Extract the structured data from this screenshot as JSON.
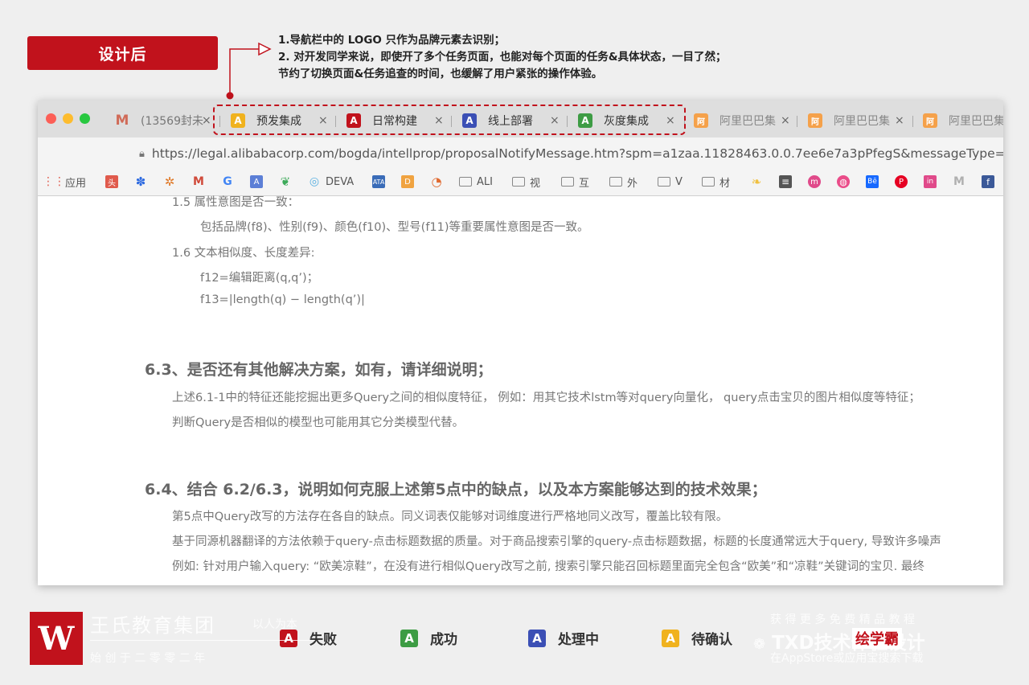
{
  "badge": "设计后",
  "notes": [
    "1.导航栏中的 LOGO 只作为品牌元素去识别；",
    "2. 对开发同学来说，即使开了多个任务页面，也能对每个页面的任务&具体状态，一目了然；",
    "节约了切换页面&任务追查的时间，也缓解了用户紧张的操作体验。"
  ],
  "colors": {
    "fail": "#c1121c",
    "success": "#3d9c44",
    "processing": "#3b4fb5",
    "pending": "#f0b21e"
  },
  "tabs": [
    {
      "label": "(13569封未",
      "icon": "M",
      "status": "gmail"
    },
    {
      "label": "预发集成",
      "icon": "A",
      "status": "pending"
    },
    {
      "label": "日常构建",
      "icon": "A",
      "status": "fail"
    },
    {
      "label": "线上部署",
      "icon": "A",
      "status": "processing"
    },
    {
      "label": "灰度集成",
      "icon": "A",
      "status": "success"
    },
    {
      "label": "阿里巴巴集",
      "icon": "logo",
      "status": "ali"
    },
    {
      "label": "阿里巴巴集",
      "icon": "logo",
      "status": "ali"
    },
    {
      "label": "阿里巴巴集",
      "icon": "logo",
      "status": "ali"
    }
  ],
  "close_glyph": "×",
  "url": "https://legal.alibabacorp.com/bogda/intellprop/proposalNotifyMessage.htm?spm=a1zaa.11828463.0.0.7ee6e7a3pPfegS&messageType=bogda_",
  "bookmarks": [
    "应用",
    "DEVA",
    "ALI",
    "视",
    "互",
    "外",
    "V",
    "材"
  ],
  "content": {
    "l0": "1.5 属性意图是否一致：",
    "l1": "包括品牌(f8)、性别(f9)、颜色(f10)、型号(f11)等重要属性意图是否一致。",
    "l2": "1.6 文本相似度、长度差异:",
    "l3": "f12=编辑距离(q,q’)；",
    "l4": "f13=|length(q) − length(q’)|",
    "h1": "6.3、是否还有其他解决方案，如有，请详细说明；",
    "p1": "上述6.1-1中的特征还能挖掘出更多Query之间的相似度特征， 例如：用其它技术lstm等对query向量化， query点击宝贝的图片相似度等特征；",
    "p2": "判断Query是否相似的模型也可能用其它分类模型代替。",
    "h2": "6.4、结合 6.2/6.3，说明如何克服上述第5点中的缺点，以及本方案能够达到的技术效果；",
    "p3": "第5点中Query改写的方法存在各自的缺点。同义词表仅能够对词维度进行严格地同义改写，覆盖比较有限。",
    "p4": "基于同源机器翻译的方法依赖于query-点击标题数据的质量。对于商品搜索引擎的query-点击标题数据，标题的长度通常远大于query, 导致许多噪声",
    "p5": "例如: 针对用户输入query: “欧美凉鞋”，在没有进行相似Query改写之前, 搜索引擎只能召回标题里面完全包含“欧美”和“凉鞋”关键词的宝贝. 最终"
  },
  "legend": [
    {
      "icon": "A",
      "label": "失败",
      "status": "fail"
    },
    {
      "icon": "A",
      "label": "成功",
      "status": "success"
    },
    {
      "icon": "A",
      "label": "处理中",
      "status": "processing"
    },
    {
      "icon": "A",
      "label": "待确认",
      "status": "pending"
    }
  ],
  "watermark": {
    "org": "王氏教育集团",
    "slogan": "以人为本",
    "founded": "始 创 于 二 零 零 二 年",
    "brand": "TXD技术体验设计",
    "promo1": "获 得 更 多 免 费 精 品 教 程",
    "promo2": "在AppStore或应用宝搜索下载",
    "app": "绘学霸"
  }
}
